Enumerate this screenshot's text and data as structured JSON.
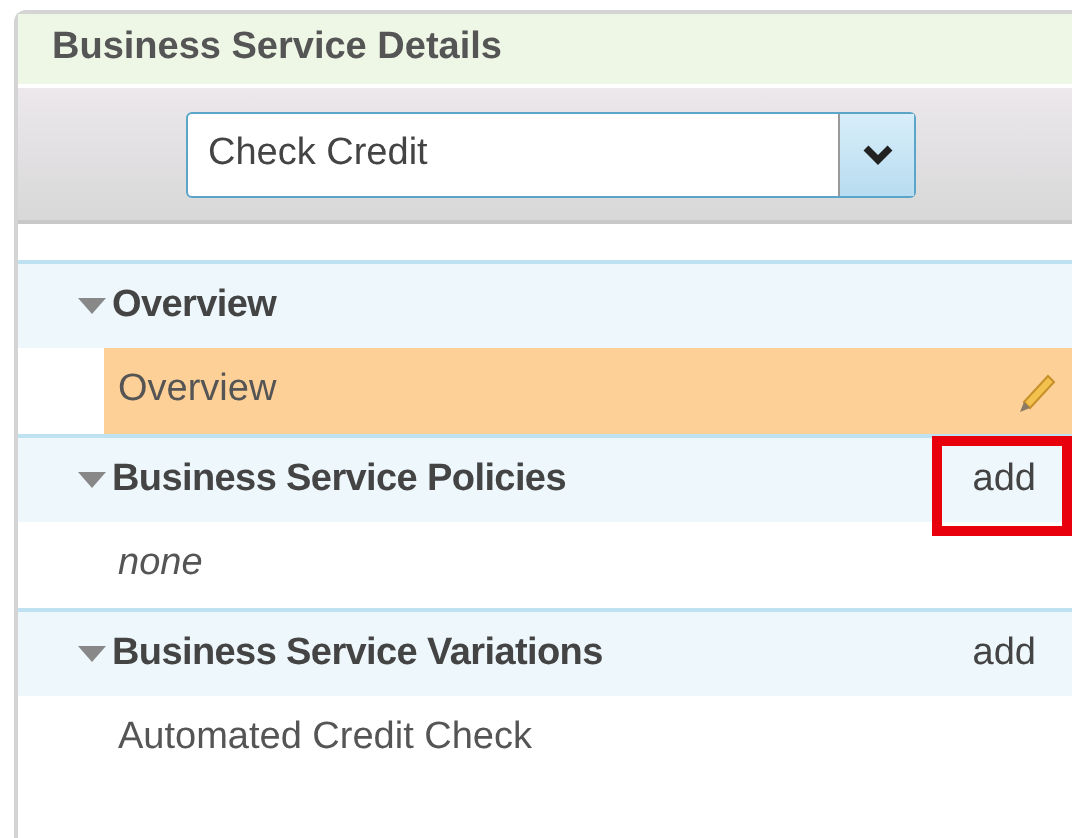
{
  "panel": {
    "title": "Business Service Details"
  },
  "dropdown": {
    "value": "Check Credit"
  },
  "sections": [
    {
      "title": "Overview",
      "expanded": true,
      "items": [
        {
          "kind": "item",
          "label": "Overview",
          "selected": true
        }
      ]
    },
    {
      "title": "Business Service Policies",
      "expanded": true,
      "action": {
        "label": "add",
        "highlighted": true
      },
      "items": [
        {
          "kind": "empty",
          "label": "none",
          "selected": false
        }
      ]
    },
    {
      "title": "Business Service Variations",
      "expanded": true,
      "action": {
        "label": "add",
        "highlighted": false
      },
      "items": [
        {
          "kind": "item",
          "label": "Automated Credit Check",
          "selected": false
        }
      ]
    }
  ]
}
